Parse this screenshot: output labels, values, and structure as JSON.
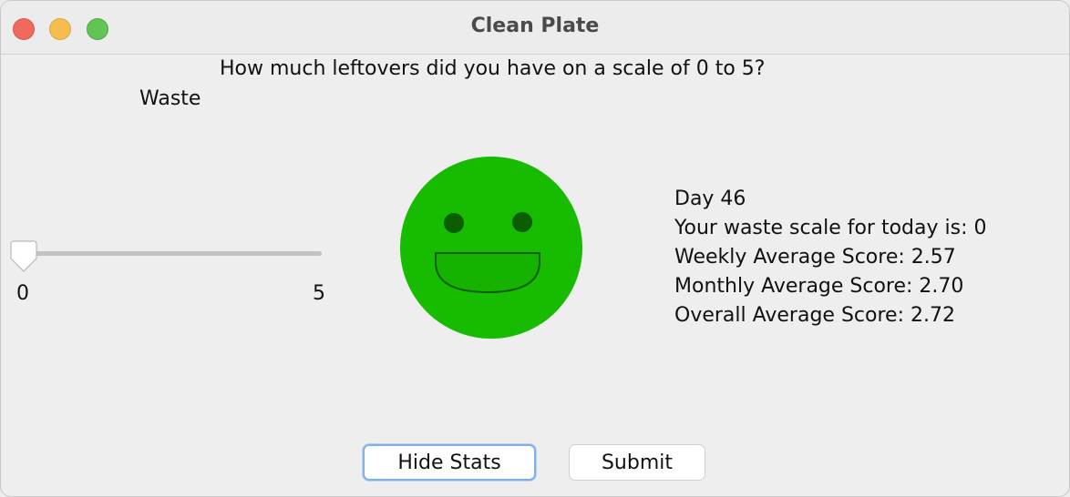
{
  "window": {
    "title": "Clean Plate"
  },
  "prompt": {
    "question": "How much leftovers did you have on a scale of 0 to 5?"
  },
  "slider": {
    "label": "Waste",
    "min_label": "0",
    "max_label": "5",
    "value": 0,
    "min": 0,
    "max": 5
  },
  "face": {
    "mood": "happy",
    "color": "#17bb00",
    "feature_color": "#0c5c00"
  },
  "stats": {
    "day": "Day 46",
    "today": "Your waste scale for today is: 0",
    "weekly": "Weekly Average Score: 2.57",
    "monthly": "Monthly Average Score: 2.70",
    "overall": "Overall Average Score: 2.72"
  },
  "buttons": {
    "hide_stats": "Hide Stats",
    "submit": "Submit"
  }
}
